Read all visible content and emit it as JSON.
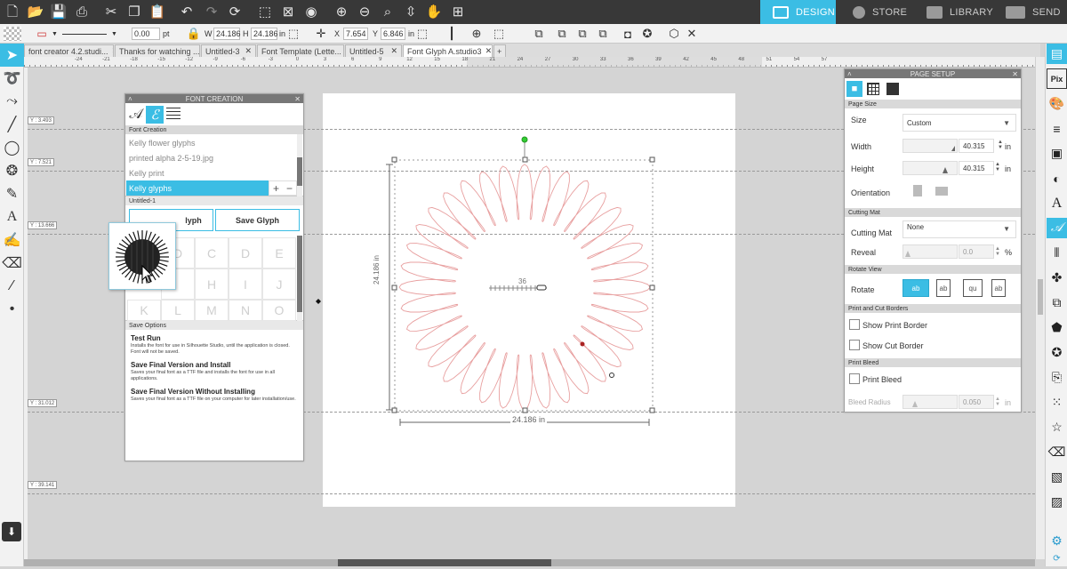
{
  "nav": {
    "design_label": "DESIGN",
    "store_label": "STORE",
    "library_label": "LIBRARY",
    "send_label": "SEND",
    "accent": "#3bbde4"
  },
  "options": {
    "line_width_value": "0.00",
    "line_width_unit": "pt",
    "w_label": "W",
    "w_value": "24.186",
    "h_label": "H",
    "h_value": "24.186",
    "size_unit": "in",
    "x_label": "X",
    "x_value": "7.654",
    "y_label": "Y",
    "y_value": "6.846",
    "pos_unit": "in"
  },
  "doc_tabs": [
    {
      "label": "font creator 4.2.studi..."
    },
    {
      "label": "Thanks for watching ..."
    },
    {
      "label": "Untitled-3"
    },
    {
      "label": "Font Template (Lette..."
    },
    {
      "label": "Untitled-5"
    },
    {
      "label": "Font Glyph A.studio3"
    }
  ],
  "add_tab_label": "+",
  "guides": [
    "Y : 3.493",
    "Y : 7.521",
    "Y : 13.666",
    "Y : 31.012",
    "Y : 39.141"
  ],
  "ruler_labels": [
    "-24",
    "-21",
    "-18",
    "-15",
    "-12",
    "-9",
    "-6",
    "-3",
    "0",
    "3",
    "6",
    "9",
    "12",
    "15",
    "18",
    "21",
    "24",
    "27",
    "30",
    "33",
    "36",
    "39",
    "42",
    "45",
    "48",
    "51",
    "54",
    "57"
  ],
  "font_panel": {
    "title": "FONT CREATION",
    "section_font_creation": "Font Creation",
    "items": [
      "Kelly flower glyphs",
      "printed alpha 2-5-19.jpg",
      "Kelly print",
      "Kelly glyphs"
    ],
    "selected_item": "Kelly glyphs",
    "add_label": "+",
    "remove_label": "−",
    "section_untitled": "Untitled-1",
    "edit_glyph_label": "Edit Glyph",
    "edit_glyph_visible": "lyph",
    "save_glyph_label": "Save Glyph",
    "glyphs": [
      "D",
      "E",
      "C",
      "D",
      "E",
      "H",
      "I",
      "J",
      "K",
      "L",
      "M",
      "N",
      "O"
    ],
    "section_save": "Save Options",
    "opt1_title": "Test Run",
    "opt1_desc": "Installs the font for use in Silhouette Studio, until the application is closed. Font will not be saved.",
    "opt2_title": "Save Final Version and Install",
    "opt2_desc": "Saves your final font as a TTF file and installs the font for use in all applications.",
    "opt3_title": "Save Final Version Without Installing",
    "opt3_desc": "Saves your final font as a TTF file on your computer for later installation/use."
  },
  "canvas": {
    "dim_bottom": "24.186 in",
    "dim_left": "24.186 in",
    "angle_label": "36",
    "shape_color": "#e8a0a0",
    "petal_count": 36
  },
  "page_setup": {
    "title": "PAGE SETUP",
    "section_page_size": "Page Size",
    "size_label": "Size",
    "size_value": "Custom",
    "width_label": "Width",
    "width_value": "40.315",
    "height_label": "Height",
    "height_value": "40.315",
    "unit": "in",
    "orientation_label": "Orientation",
    "section_cutting_mat": "Cutting Mat",
    "cutting_mat_label": "Cutting Mat",
    "cutting_mat_value": "None",
    "reveal_label": "Reveal",
    "reveal_value": "0.0",
    "reveal_unit": "%",
    "section_rotate_view": "Rotate View",
    "rotate_label": "Rotate",
    "rotate_options": [
      "ab",
      "ab",
      "qu",
      "ab"
    ],
    "section_borders": "Print and Cut Borders",
    "show_print_border": "Show Print Border",
    "show_cut_border": "Show Cut Border",
    "section_bleed": "Print Bleed",
    "print_bleed": "Print Bleed",
    "bleed_radius_label": "Bleed Radius",
    "bleed_radius_value": "0.050"
  }
}
